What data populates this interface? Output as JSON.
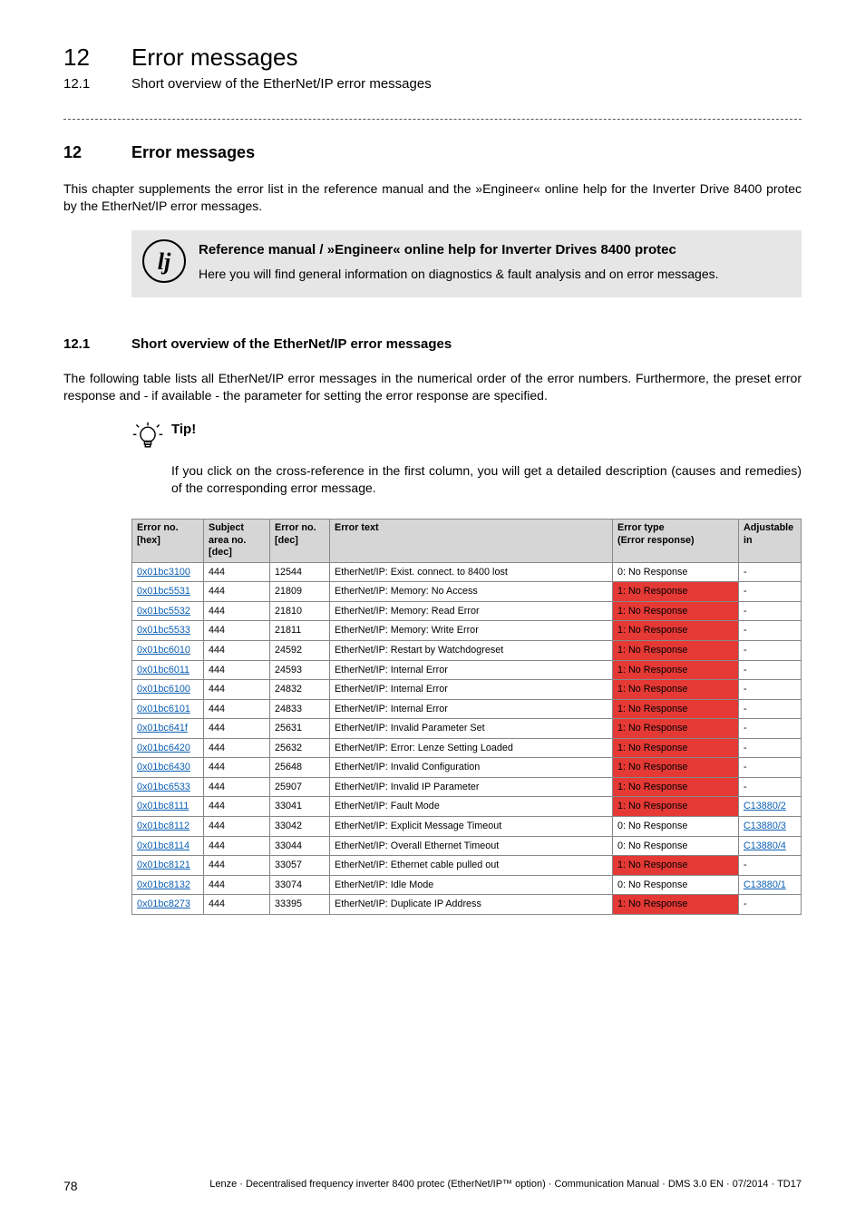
{
  "header": {
    "chapter_num": "12",
    "chapter_title": "Error messages",
    "sub_num": "12.1",
    "sub_title": "Short overview of the EtherNet/IP error messages"
  },
  "section": {
    "num": "12",
    "title": "Error messages",
    "intro": "This chapter supplements the error list in the reference manual and the »Engineer« online help for the Inverter Drive 8400 protec by the EtherNet/IP error messages."
  },
  "callout": {
    "icon_glyph": "lj",
    "title": "Reference manual / »Engineer« online help for Inverter Drives 8400 protec",
    "body": "Here you will find general information on diagnostics & fault analysis and on error messages."
  },
  "subsection": {
    "num": "12.1",
    "title": "Short overview of the EtherNet/IP error messages",
    "para": "The following table lists all EtherNet/IP error messages in the numerical order of the error numbers. Furthermore, the preset error response and - if available - the parameter for setting the error response are specified."
  },
  "tip": {
    "label": "Tip!",
    "body": "If you click on the cross-reference in the first column, you will get a detailed description (causes and remedies) of the corresponding error message."
  },
  "table": {
    "headers": {
      "c1": "Error no.\n[hex]",
      "c2": "Subject area no.\n[dec]",
      "c3": "Error no.\n[dec]",
      "c4": "Error text",
      "c5": "Error type\n(Error response)",
      "c6": "Adjustable in"
    },
    "rows": [
      {
        "hex": "0x01bc3100",
        "area": "444",
        "dec": "12544",
        "text": "EtherNet/IP: Exist. connect. to 8400 lost",
        "type": "0: No Response",
        "type_red": false,
        "adj": "-",
        "adj_link": false
      },
      {
        "hex": "0x01bc5531",
        "area": "444",
        "dec": "21809",
        "text": "EtherNet/IP: Memory: No Access",
        "type": "1: No Response",
        "type_red": true,
        "adj": "-",
        "adj_link": false
      },
      {
        "hex": "0x01bc5532",
        "area": "444",
        "dec": "21810",
        "text": "EtherNet/IP: Memory: Read Error",
        "type": "1: No Response",
        "type_red": true,
        "adj": "-",
        "adj_link": false
      },
      {
        "hex": "0x01bc5533",
        "area": "444",
        "dec": "21811",
        "text": "EtherNet/IP: Memory: Write Error",
        "type": "1: No Response",
        "type_red": true,
        "adj": "-",
        "adj_link": false
      },
      {
        "hex": "0x01bc6010",
        "area": "444",
        "dec": "24592",
        "text": "EtherNet/IP: Restart by Watchdogreset",
        "type": "1: No Response",
        "type_red": true,
        "adj": "-",
        "adj_link": false
      },
      {
        "hex": "0x01bc6011",
        "area": "444",
        "dec": "24593",
        "text": "EtherNet/IP: Internal Error",
        "type": "1: No Response",
        "type_red": true,
        "adj": "-",
        "adj_link": false
      },
      {
        "hex": "0x01bc6100",
        "area": "444",
        "dec": "24832",
        "text": "EtherNet/IP: Internal Error",
        "type": "1: No Response",
        "type_red": true,
        "adj": "-",
        "adj_link": false
      },
      {
        "hex": "0x01bc6101",
        "area": "444",
        "dec": "24833",
        "text": "EtherNet/IP: Internal Error",
        "type": "1: No Response",
        "type_red": true,
        "adj": "-",
        "adj_link": false
      },
      {
        "hex": "0x01bc641f",
        "area": "444",
        "dec": "25631",
        "text": "EtherNet/IP: Invalid Parameter Set",
        "type": "1: No Response",
        "type_red": true,
        "adj": "-",
        "adj_link": false
      },
      {
        "hex": "0x01bc6420",
        "area": "444",
        "dec": "25632",
        "text": "EtherNet/IP: Error: Lenze Setting Loaded",
        "type": "1: No Response",
        "type_red": true,
        "adj": "-",
        "adj_link": false
      },
      {
        "hex": "0x01bc6430",
        "area": "444",
        "dec": "25648",
        "text": "EtherNet/IP: Invalid Configuration",
        "type": "1: No Response",
        "type_red": true,
        "adj": "-",
        "adj_link": false
      },
      {
        "hex": "0x01bc6533",
        "area": "444",
        "dec": "25907",
        "text": "EtherNet/IP: Invalid IP Parameter",
        "type": "1: No Response",
        "type_red": true,
        "adj": "-",
        "adj_link": false
      },
      {
        "hex": "0x01bc8111",
        "area": "444",
        "dec": "33041",
        "text": "EtherNet/IP: Fault Mode",
        "type": "1: No Response",
        "type_red": true,
        "adj": "C13880/2",
        "adj_link": true
      },
      {
        "hex": "0x01bc8112",
        "area": "444",
        "dec": "33042",
        "text": "EtherNet/IP: Explicit Message Timeout",
        "type": "0: No Response",
        "type_red": false,
        "adj": "C13880/3",
        "adj_link": true
      },
      {
        "hex": "0x01bc8114",
        "area": "444",
        "dec": "33044",
        "text": "EtherNet/IP: Overall Ethernet Timeout",
        "type": "0: No Response",
        "type_red": false,
        "adj": "C13880/4",
        "adj_link": true
      },
      {
        "hex": "0x01bc8121",
        "area": "444",
        "dec": "33057",
        "text": "EtherNet/IP: Ethernet cable pulled out",
        "type": "1: No Response",
        "type_red": true,
        "adj": "-",
        "adj_link": false
      },
      {
        "hex": "0x01bc8132",
        "area": "444",
        "dec": "33074",
        "text": "EtherNet/IP: Idle Mode",
        "type": "0: No Response",
        "type_red": false,
        "adj": "C13880/1",
        "adj_link": true
      },
      {
        "hex": "0x01bc8273",
        "area": "444",
        "dec": "33395",
        "text": "EtherNet/IP: Duplicate IP Address",
        "type": "1: No Response",
        "type_red": true,
        "adj": "-",
        "adj_link": false
      }
    ]
  },
  "footer": {
    "page": "78",
    "line": "Lenze · Decentralised frequency inverter 8400 protec (EtherNet/IP™ option) · Communication Manual · DMS 3.0 EN · 07/2014 · TD17"
  }
}
